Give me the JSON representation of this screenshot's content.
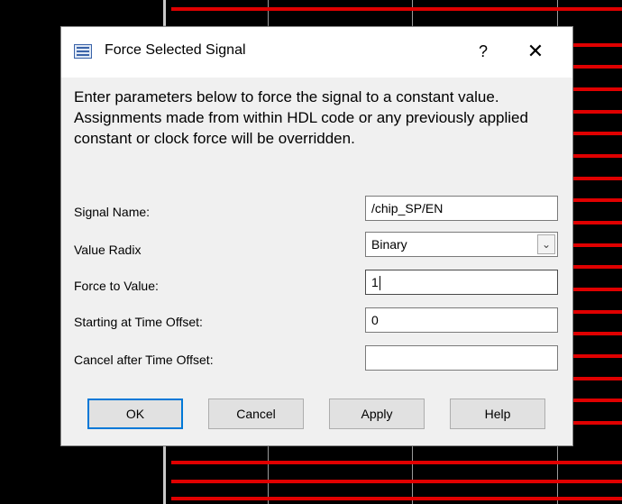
{
  "dialog": {
    "title": "Force Selected Signal",
    "help_glyph": "?",
    "close_glyph": "✕",
    "description": "Enter parameters below to force the signal to a constant value. Assignments made from within HDL code or any previously applied constant or clock force will be overridden.",
    "fields": {
      "signal_name": {
        "label": "Signal Name:",
        "value": "/chip_SP/EN"
      },
      "value_radix": {
        "label": "Value Radix",
        "value": "Binary"
      },
      "force_value": {
        "label": "Force to Value:",
        "value": "1"
      },
      "start_offset": {
        "label": "Starting at Time Offset:",
        "value": "0"
      },
      "cancel_offset": {
        "label": "Cancel after Time Offset:",
        "value": ""
      }
    },
    "buttons": {
      "ok": "OK",
      "cancel": "Cancel",
      "apply": "Apply",
      "help": "Help"
    },
    "accent_color": "#0078d7"
  },
  "background": {
    "trace_color": "#e00000",
    "bg_color": "#000000"
  }
}
